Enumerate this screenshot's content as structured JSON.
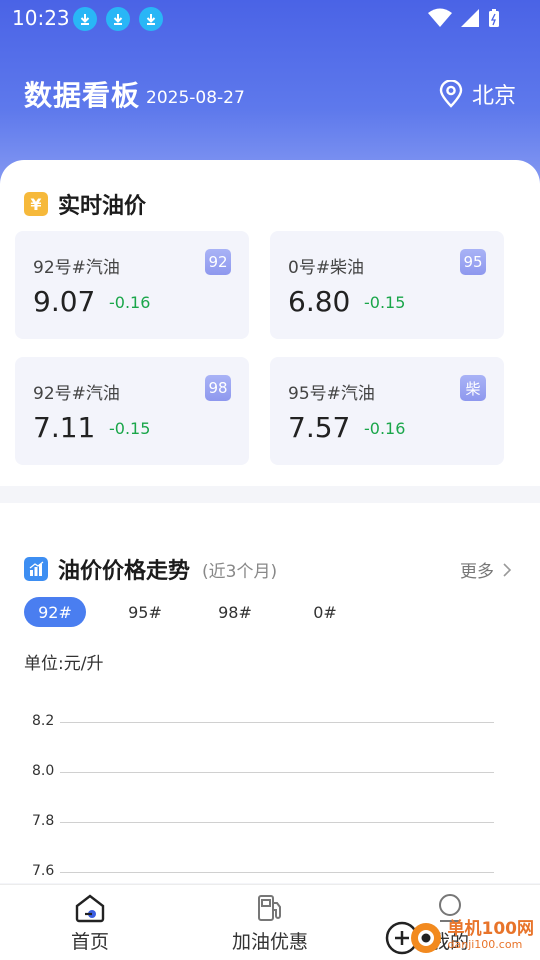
{
  "status": {
    "time": "10:23"
  },
  "header": {
    "title": "数据看板",
    "date": "2025-08-27",
    "location": "北京"
  },
  "realtime": {
    "title": "实时油价",
    "icon_glyph": "¥",
    "cards": [
      {
        "name": "92号#汽油",
        "badge": "92",
        "price": "9.07",
        "change": "-0.16"
      },
      {
        "name": "0号#柴油",
        "badge": "95",
        "price": "6.80",
        "change": "-0.15"
      },
      {
        "name": "92号#汽油",
        "badge": "98",
        "price": "7.11",
        "change": "-0.15"
      },
      {
        "name": "95号#汽油",
        "badge": "柴",
        "price": "7.57",
        "change": "-0.16"
      }
    ]
  },
  "trend": {
    "title": "油价价格走势",
    "subtitle": "(近3个月)",
    "more": "更多",
    "tabs": [
      "92#",
      "95#",
      "98#",
      "0#"
    ],
    "active_tab": "92#",
    "unit": "单位:元/升"
  },
  "chart_data": {
    "type": "line",
    "ylabel": "单位:元/升",
    "y_ticks": [
      "8.2",
      "8.0",
      "7.8",
      "7.6"
    ],
    "series": []
  },
  "nav": {
    "items": [
      "首页",
      "加油优惠",
      "我的"
    ]
  },
  "watermark": {
    "text": "单机100网",
    "url": "danji100.com"
  },
  "colors": {
    "accent": "#4a7ef0",
    "header": "#4a63e6",
    "change_down": "#1aa64a",
    "badge": "#9aa4f2"
  }
}
